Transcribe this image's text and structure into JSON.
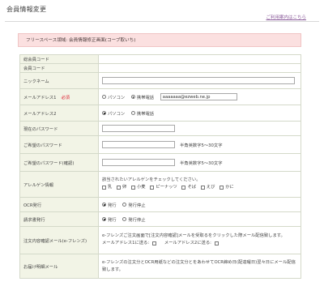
{
  "page": {
    "title": "会員情報変更",
    "guide_link": "ご利用案内はこちら",
    "notice": "フリースペース領域: 会員情報修正画面(コーブ取いち)"
  },
  "rows": {
    "member_code_total": {
      "label": "総会員コード"
    },
    "member_code": {
      "label": "会員コード"
    },
    "nickname": {
      "label": "ニックネーム",
      "value": ""
    },
    "mail1": {
      "label": "メールアドレス1",
      "required": "必須",
      "opt_pc": "パソコン",
      "opt_mobile": "携帯電話",
      "selected": "mobile",
      "value": "aaaaaaa@ezweb.ne.jp"
    },
    "mail2": {
      "label": "メールアドレス2",
      "opt_pc": "パソコン",
      "opt_mobile": "携帯電話",
      "selected": "pc"
    },
    "current_password": {
      "label": "現在のパスワード",
      "value": ""
    },
    "new_password": {
      "label": "ご希望のパスワード",
      "value": "",
      "hint": "半角英数字5～30文字"
    },
    "new_password_confirm": {
      "label": "ご希望のパスワード(確認)",
      "value": "",
      "hint": "半角英数字5～30文字"
    },
    "allergy": {
      "label": "アレルゲン情報",
      "intro": "該当されたいアレルゲンをチェックしてください。",
      "items": [
        "乳",
        "卵",
        "小麦",
        "ピーナッツ",
        "そば",
        "えび",
        "かに"
      ]
    },
    "ocr": {
      "label": "OCR発行",
      "opt_on": "発行",
      "opt_off": "発行停止",
      "selected": "on"
    },
    "invoice": {
      "label": "請求書発行",
      "opt_on": "発行",
      "opt_off": "発行停止",
      "selected": "on"
    },
    "order_mail": {
      "label": "注文内容確認メール(e-フレンズ)",
      "line1": "e-フレンズご注文画面で[注文内容確認]メールを受取るをクリックした際メール配信致します。",
      "line2": "メールアドレス1に送る:",
      "line3": "メールアドレス2に送る:"
    },
    "delivery_mail": {
      "label": "お届け明細メール",
      "line1": "e-フレンズの注文分とOCR用紙などの注文分とをあわせてOCR締め日(配達曜日)翌々日にメール配信致します。"
    }
  }
}
